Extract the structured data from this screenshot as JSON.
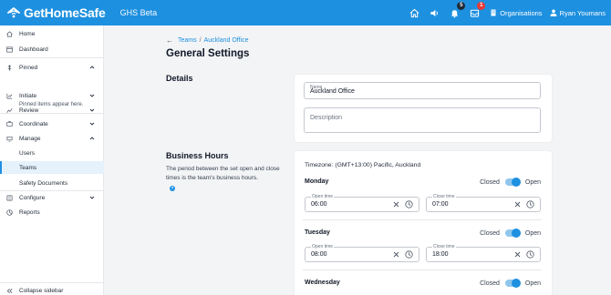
{
  "app": {
    "logo_text": "GetHomeSafe",
    "env_label": "GHS Beta"
  },
  "topbar": {
    "notification_count": "5",
    "inbox_count": "1",
    "organisations_label": "Organisations",
    "user_name": "Ryan Youmans"
  },
  "sidebar": {
    "items": [
      {
        "label": "Home",
        "icon": "home-icon"
      },
      {
        "label": "Dashboard",
        "icon": "dashboard-icon"
      },
      {
        "label": "Pinned",
        "icon": "pin-icon"
      },
      {
        "label": "Initiate",
        "icon": "initiate-icon"
      },
      {
        "label": "Review",
        "icon": "review-icon"
      },
      {
        "label": "Coordinate",
        "icon": "coordinate-icon"
      },
      {
        "label": "Manage",
        "icon": "manage-icon"
      },
      {
        "label": "Users"
      },
      {
        "label": "Teams"
      },
      {
        "label": "Safety Documents"
      },
      {
        "label": "Configure",
        "icon": "configure-icon"
      },
      {
        "label": "Reports",
        "icon": "reports-icon"
      }
    ],
    "pinned_hint": "Pinned items appear here.",
    "collapse_label": "Collapse sidebar"
  },
  "breadcrumb": {
    "parent": "Teams",
    "current": "Auckland Office"
  },
  "page_title": "General Settings",
  "details": {
    "section_title": "Details",
    "name_label": "Name",
    "name_value": "Auckland Office",
    "description_placeholder": "Description"
  },
  "business_hours": {
    "section_title": "Business Hours",
    "description": "The period between the set open and close times is the team's business hours.",
    "timezone": "Timezone: (GMT+13:00) Pacific, Auckland",
    "closed_label": "Closed",
    "open_label": "Open",
    "open_time_label": "Open time",
    "close_time_label": "Close time",
    "days": [
      {
        "name": "Monday",
        "is_open": true,
        "open_time": "06:00",
        "close_time": "07:00"
      },
      {
        "name": "Tuesday",
        "is_open": true,
        "open_time": "08:00",
        "close_time": "18:00"
      },
      {
        "name": "Wednesday",
        "is_open": true
      }
    ]
  },
  "colors": {
    "brand": "#1e90e0",
    "badge_red": "#e53935"
  }
}
